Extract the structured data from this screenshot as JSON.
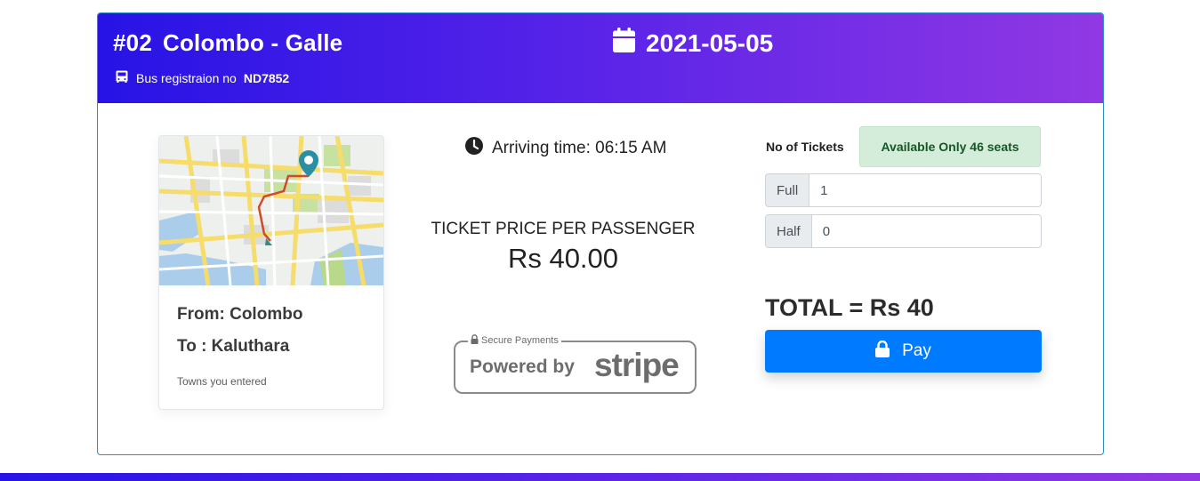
{
  "header": {
    "route_number": "#02",
    "route_name": "Colombo - Galle",
    "bus_reg_label": "Bus registraion no",
    "bus_reg_number": "ND7852",
    "date": "2021-05-05",
    "bus_icon": "bus-icon",
    "calendar_icon": "calendar-icon"
  },
  "route_card": {
    "map_icon": "map-image",
    "from_text": "From: Colombo",
    "to_text": "To : Kaluthara",
    "note": "Towns you entered"
  },
  "trip": {
    "clock_icon": "clock-icon",
    "arriving_text": "Arriving time: 06:15 AM",
    "price_label": "TICKET PRICE PER PASSENGER",
    "price_value": "Rs 40.00"
  },
  "stripe": {
    "secure_text": "Secure Payments",
    "powered_text": "Powered by",
    "brand": "stripe"
  },
  "booking": {
    "tickets_label": "No of Tickets",
    "availability": "Available Only 46 seats",
    "full_label": "Full",
    "full_value": "1",
    "half_label": "Half",
    "half_value": "0",
    "total_text": "TOTAL = Rs 40",
    "pay_label": "Pay",
    "lock_icon": "lock-icon"
  },
  "colors": {
    "gradient_start": "#2713e6",
    "gradient_end": "#9138e3",
    "pay_button": "#007bff",
    "availability_bg": "#d4edda",
    "availability_text": "#155724"
  }
}
